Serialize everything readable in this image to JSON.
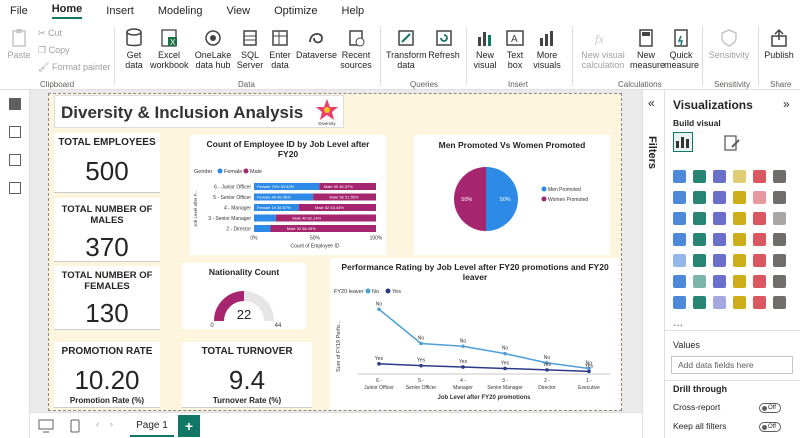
{
  "menu": [
    "File",
    "Home",
    "Insert",
    "Modeling",
    "View",
    "Optimize",
    "Help"
  ],
  "ribbon": {
    "clipboard": {
      "paste": "Paste",
      "cut": "Cut",
      "copy": "Copy",
      "format_painter": "Format painter",
      "group": "Clipboard"
    },
    "data": {
      "get_data": "Get data",
      "excel": "Excel workbook",
      "onelake": "OneLake data hub",
      "sql": "SQL Server",
      "enter": "Enter data",
      "dataverse": "Dataverse",
      "recent": "Recent sources",
      "group": "Data"
    },
    "queries": {
      "transform": "Transform data",
      "refresh": "Refresh",
      "group": "Queries"
    },
    "insert": {
      "new_visual": "New visual",
      "text_box": "Text box",
      "more_visuals": "More visuals",
      "group": "Insert"
    },
    "calculations": {
      "new_visual_calc": "New visual calculation",
      "new_measure": "New measure",
      "quick_measure": "Quick measure",
      "group": "Calculations"
    },
    "sensitivity": {
      "label": "Sensitivity",
      "group": "Sensitivity"
    },
    "share": {
      "publish": "Publish",
      "group": "Share"
    }
  },
  "report": {
    "title": "Diversity & Inclusion Analysis",
    "logo_text": "Diversity",
    "cards": {
      "total_employees": {
        "label": "TOTAL EMPLOYEES",
        "value": "500"
      },
      "males": {
        "label": "TOTAL NUMBER OF MALES",
        "value": "370"
      },
      "females": {
        "label": "TOTAL NUMBER OF FEMALES",
        "value": "130"
      },
      "promotion": {
        "label": "PROMOTION RATE",
        "value": "10.20",
        "sub": "Promotion Rate (%)"
      },
      "turnover": {
        "label": "TOTAL TURNOVER",
        "value": "9.4",
        "sub": "Turnover Rate (%)"
      }
    },
    "bar_chart_title": "Count of Employee ID by Job Level after FY20",
    "pie_title": "Men Promoted Vs Women Promoted",
    "gauge_title": "Nationality Count",
    "line_title": "Performance Rating by Job Level after FY20 promotions and FY20 leaver",
    "colors": {
      "male": "#a5256f",
      "female": "#2d8ae6",
      "no_line": "#4f9fd6",
      "yes_line": "#2b3a86"
    }
  },
  "chart_data": [
    {
      "type": "bar",
      "title": "Count of Employee ID by Job Level after FY20",
      "legend_title": "Gender",
      "legend": [
        "Female",
        "Male"
      ],
      "categories": [
        "6 - Junior Officer",
        "5 - Senior Officer",
        "4 - Manager",
        "3 - Senior Manager",
        "2 - Director"
      ],
      "series": [
        {
          "name": "Female",
          "values": [
            53.63,
            48.46,
            36.57,
            17.86,
            13.51
          ],
          "labels": [
            "Female 70% 53.63%",
            "Female 48 46.46%",
            "Female 19 36.57%",
            "",
            ""
          ]
        },
        {
          "name": "Male",
          "values": [
            46.37,
            51.54,
            63.43,
            82.14,
            86.49
          ],
          "labels": [
            "Male 95 46.37%",
            "Male 56 51.55%",
            "Male 52 63.43%",
            "Male 40 82.14%",
            "Male 32 86.49%"
          ]
        }
      ],
      "ticks": [
        "0%",
        "50%",
        "100%"
      ],
      "xlabel": "Count of Employee ID",
      "ylabel": "Job Level after F..."
    },
    {
      "type": "pie",
      "title": "Men Promoted Vs Women Promoted",
      "categories": [
        "Men Promoted",
        "Women Promoted"
      ],
      "values": [
        50,
        50
      ],
      "labels": [
        "50%",
        "50%"
      ]
    },
    {
      "type": "gauge",
      "title": "Nationality Count",
      "value": 22,
      "min": 0,
      "max": 44
    },
    {
      "type": "line",
      "title": "Performance Rating by Job Level after FY20 promotions and FY20 leaver",
      "legend_title": "FY20 leaver",
      "categories": [
        "6 - Junior Officer",
        "5 - Senior Officer",
        "4 - Manager",
        "3 - Senior Manager",
        "2 - Director",
        "1 - Executive"
      ],
      "series": [
        {
          "name": "No",
          "values": [
            350,
            165,
            150,
            110,
            60,
            30
          ]
        },
        {
          "name": "Yes",
          "values": [
            55,
            45,
            38,
            30,
            22,
            14
          ]
        }
      ],
      "xlabel": "Job Level after FY20 promotions",
      "ylabel": "Sum of FY19 Perfo...",
      "ylim": [
        0,
        400
      ]
    }
  ],
  "pagebar": {
    "page": "Page 1",
    "add": "+"
  },
  "panes": {
    "filters": "Filters",
    "visualizations": "Visualizations",
    "build_visual": "Build visual",
    "values": "Values",
    "add_fields": "Add data fields here",
    "drill_through": "Drill through",
    "cross_report": "Cross-report",
    "keep_filters": "Keep all filters",
    "off": "Off",
    "more": "..."
  }
}
